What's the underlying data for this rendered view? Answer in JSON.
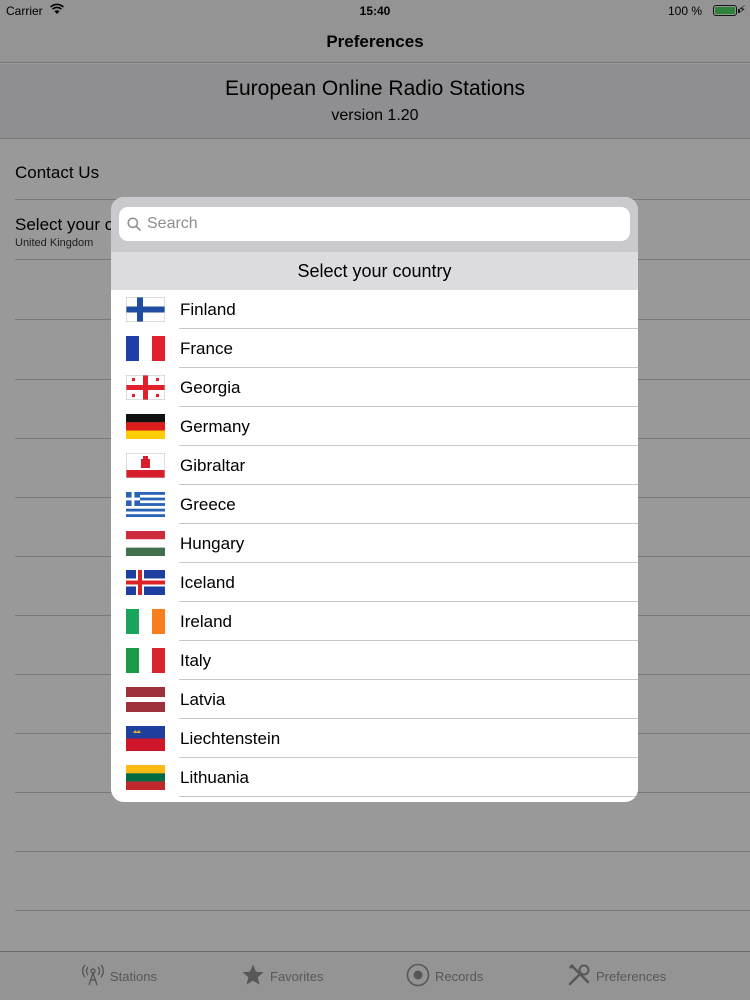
{
  "status_bar": {
    "carrier": "Carrier",
    "time": "15:40",
    "battery_percent": "100 %",
    "battery_level": 1.0
  },
  "nav_bar": {
    "title": "Preferences"
  },
  "app_info": {
    "name": "European Online Radio Stations",
    "version": "version 1.20"
  },
  "settings": {
    "contact_label": "Contact Us",
    "country_label": "Select your c",
    "country_value": "United Kingdom"
  },
  "popover": {
    "search_placeholder": "Search",
    "section_header": "Select your country",
    "countries": [
      {
        "name": "Finland",
        "flag": "finland-flag-icon"
      },
      {
        "name": "France",
        "flag": "france-flag-icon"
      },
      {
        "name": "Georgia",
        "flag": "georgia-flag-icon"
      },
      {
        "name": "Germany",
        "flag": "germany-flag-icon"
      },
      {
        "name": "Gibraltar",
        "flag": "gibraltar-flag-icon"
      },
      {
        "name": "Greece",
        "flag": "greece-flag-icon"
      },
      {
        "name": "Hungary",
        "flag": "hungary-flag-icon"
      },
      {
        "name": "Iceland",
        "flag": "iceland-flag-icon"
      },
      {
        "name": "Ireland",
        "flag": "ireland-flag-icon"
      },
      {
        "name": "Italy",
        "flag": "italy-flag-icon"
      },
      {
        "name": "Latvia",
        "flag": "latvia-flag-icon"
      },
      {
        "name": "Liechtenstein",
        "flag": "liechtenstein-flag-icon"
      },
      {
        "name": "Lithuania",
        "flag": "lithuania-flag-icon"
      }
    ]
  },
  "tab_bar": {
    "tabs": [
      {
        "label": "Stations",
        "icon": "antenna-icon"
      },
      {
        "label": "Favorites",
        "icon": "star-icon"
      },
      {
        "label": "Records",
        "icon": "record-icon"
      },
      {
        "label": "Preferences",
        "icon": "tools-icon"
      }
    ]
  },
  "colors": {
    "overlay": "#000000",
    "battery": "#4cd964",
    "tab_inactive": "#929292"
  }
}
